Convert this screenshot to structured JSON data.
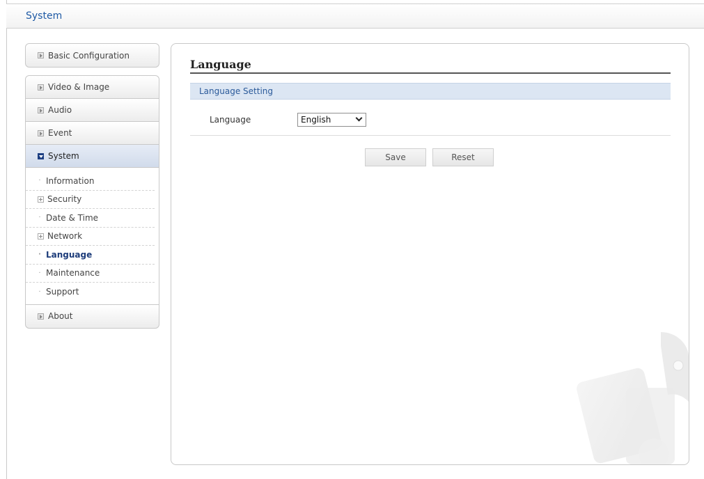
{
  "header": {
    "title": "System"
  },
  "sidebar": {
    "top_item": "Basic Configuration",
    "items": [
      "Video & Image",
      "Audio",
      "Event",
      "System"
    ],
    "submenu": [
      {
        "label": "Information",
        "icon": "bullet"
      },
      {
        "label": "Security",
        "icon": "expand-plus"
      },
      {
        "label": "Date & Time",
        "icon": "bullet"
      },
      {
        "label": "Network",
        "icon": "expand-plus"
      },
      {
        "label": "Language",
        "icon": "bullet",
        "current": true
      },
      {
        "label": "Maintenance",
        "icon": "bullet"
      },
      {
        "label": "Support",
        "icon": "bullet"
      }
    ],
    "bottom_item": "About"
  },
  "main": {
    "title": "Language",
    "section": "Language Setting",
    "field_label": "Language",
    "field_value": "English",
    "save_label": "Save",
    "reset_label": "Reset"
  },
  "colors": {
    "header_title": "#1f5aa5",
    "section_bg": "#dce6f3",
    "section_text": "#2b5a9a",
    "active_nav_bg": "#d1dbeb",
    "current_sub": "#1d3c7a"
  }
}
